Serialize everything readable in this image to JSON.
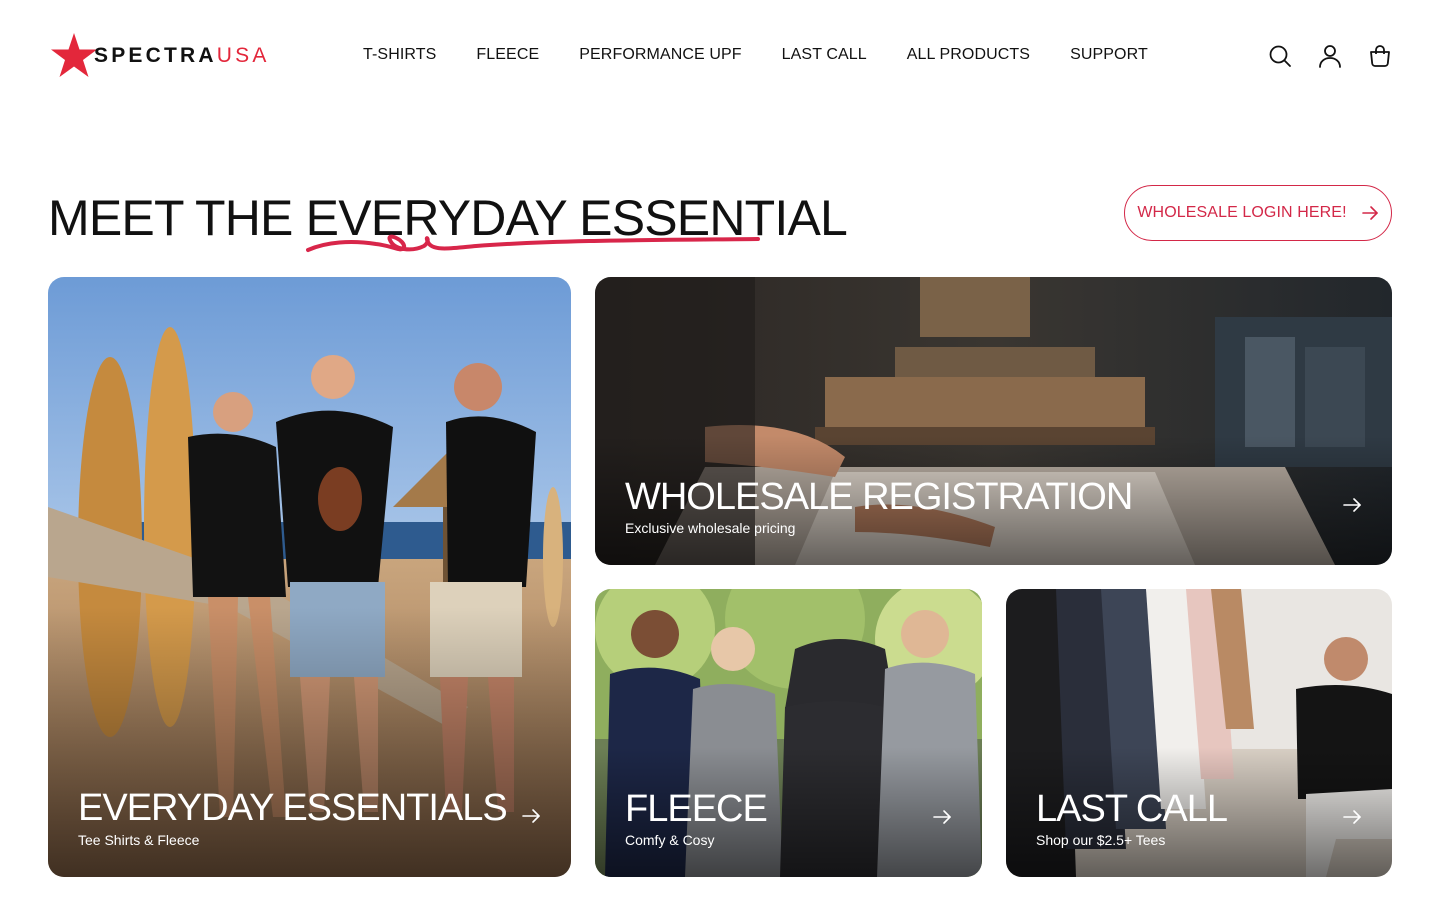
{
  "brand": {
    "name_part1": "SPECTRA",
    "name_part2": "USA",
    "accent_color": "#e3273b"
  },
  "nav": {
    "items": [
      {
        "label": "T-SHIRTS"
      },
      {
        "label": "FLEECE"
      },
      {
        "label": "PERFORMANCE UPF"
      },
      {
        "label": "LAST CALL"
      },
      {
        "label": "ALL PRODUCTS"
      },
      {
        "label": "SUPPORT"
      }
    ]
  },
  "header_icons": [
    "search-icon",
    "account-icon",
    "cart-icon"
  ],
  "hero": {
    "title_prefix": "MEET THE ",
    "title_highlight": "EVERYDAY ESSENTIAL",
    "cta_label": "WHOLESALE LOGIN HERE!",
    "cta_color": "#d32848"
  },
  "cards": [
    {
      "title": "EVERYDAY ESSENTIALS",
      "subtitle": "Tee Shirts & Fleece"
    },
    {
      "title": "WHOLESALE REGISTRATION",
      "subtitle": "Exclusive wholesale pricing"
    },
    {
      "title": "FLEECE",
      "subtitle": "Comfy & Cosy"
    },
    {
      "title": "LAST CALL",
      "subtitle": "Shop our $2.5+ Tees"
    }
  ]
}
